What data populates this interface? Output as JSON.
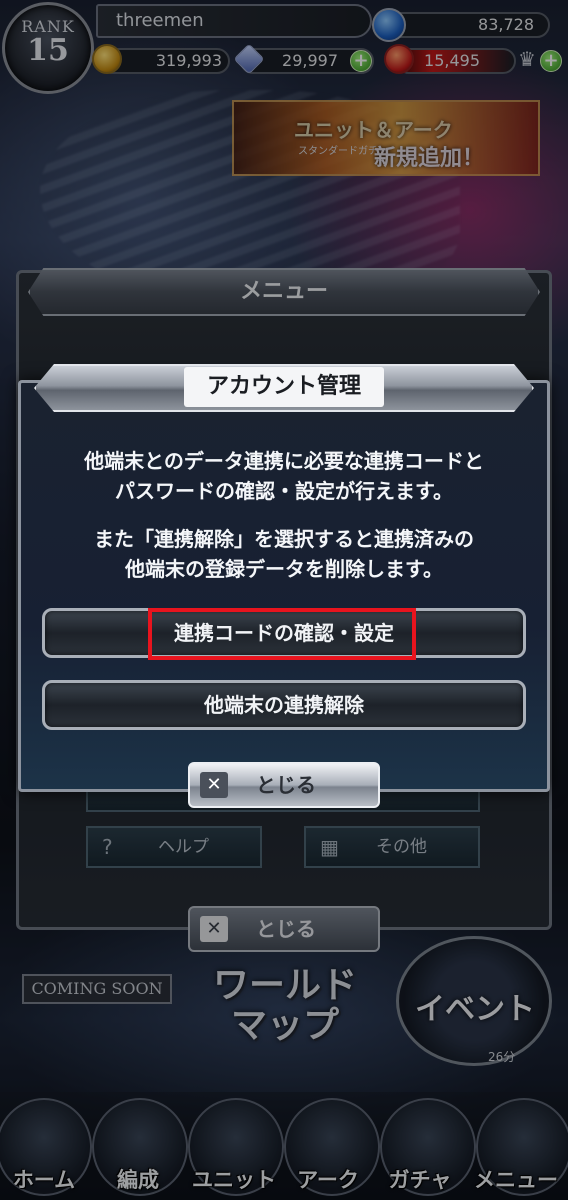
{
  "status": {
    "rank_label": "RANK",
    "rank_value": "15",
    "player_name": "threemen",
    "stones": "83,728",
    "gold": "319,993",
    "crystals": "29,997",
    "fire_points": "15,495",
    "plus": "+"
  },
  "banner": {
    "line1": "ユニット＆アーク",
    "line2": "新規追加！",
    "small": "スタンダードガチャ"
  },
  "menu": {
    "title": "メニュー",
    "help_label": "ヘルプ",
    "other_label": "その他",
    "close_label": "とじる"
  },
  "home": {
    "coming_soon": "COMING SOON",
    "world_map_line1": "ワールド",
    "world_map_line2": "マップ",
    "event_label": "イベント",
    "event_timer": "26分"
  },
  "bottom_nav": {
    "items": [
      {
        "label": "ホーム"
      },
      {
        "label": "編成"
      },
      {
        "label": "ユニット"
      },
      {
        "label": "アーク"
      },
      {
        "label": "ガチャ"
      },
      {
        "label": "メニュー"
      }
    ]
  },
  "dialog": {
    "title": "アカウント管理",
    "text1_line1": "他端末とのデータ連携に必要な連携コードと",
    "text1_line2": "パスワードの確認・設定が行えます。",
    "text2_line1": "また「連携解除」を選択すると連携済みの",
    "text2_line2": "他端末の登録データを削除します。",
    "confirm_button": "連携コードの確認・設定",
    "unlink_button": "他端末の連携解除",
    "close_label": "とじる",
    "close_icon": "✕"
  },
  "colors": {
    "highlight": "#e8141e",
    "plus_green": "#2e8f1a"
  }
}
